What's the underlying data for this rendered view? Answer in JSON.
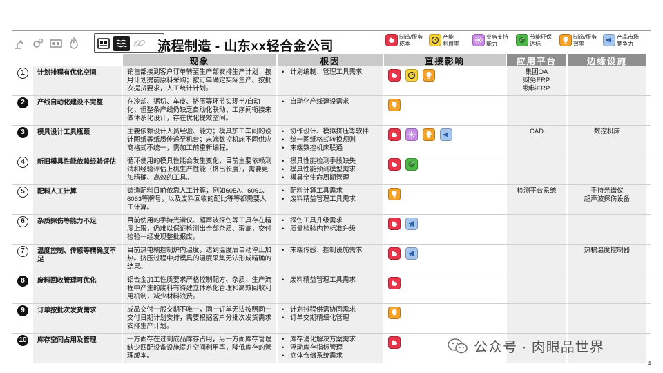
{
  "header": {
    "title": "流程制造 - 山东xx轻合金公司",
    "sector_icons": [
      "robot-arm-icon",
      "gears-icon",
      "machine-icon",
      "fire-flame-icon"
    ],
    "active_sector_icons": [
      "factory-panel-icon",
      "metal-rolls-icon",
      "chain-link-icon"
    ]
  },
  "legend": [
    {
      "key": "red",
      "label": "制造/服务\n成本",
      "color": "#e8354a",
      "icon": "piggy-bank-icon"
    },
    {
      "key": "yellow",
      "label": "产能\n利用率",
      "color": "#f6d23a",
      "icon": "gauge-icon"
    },
    {
      "key": "purple",
      "label": "业务支持\n能力",
      "color": "#c78be6",
      "icon": "star-burst-icon"
    },
    {
      "key": "green",
      "label": "节能环保\n达标",
      "color": "#4fb848",
      "icon": "leaf-globe-icon"
    },
    {
      "key": "orange",
      "label": "制造/服务\n效率",
      "color": "#f3a22a",
      "icon": "lightbulb-icon"
    },
    {
      "key": "blue",
      "label": "产品市场\n竞争力",
      "color": "#a7c6ee",
      "icon": "megaphone-icon"
    }
  ],
  "columns": {
    "phenomenon": "现象",
    "cause": "根因",
    "impact": "直接影响",
    "platform": "应用平台",
    "infrastructure": "边缘设施"
  },
  "rows": [
    {
      "num": "1",
      "style": "outline",
      "title": "计划排程有优化空间",
      "phenomenon": "销售部接到客户订单转至生产部安排生产计划；按月计划提前原料采购；按订单确定实际生产、按批次提货要求，人工统计计划。",
      "causes": [
        "计划编制、管理工具需求"
      ],
      "impacts": [
        "red",
        "yellow",
        "orange"
      ],
      "platform": "集团OA\n财务ERP\n物料ERP",
      "infra": ""
    },
    {
      "num": "2",
      "style": "filled",
      "title": "产线自动化建设不完整",
      "phenomenon": "在冷却、锯切、车皮、挤压等环节实现半/自动化，但整条产线仍缺乏自动化联动；工序间衔接未做体系化设计，存在优化提效空间。",
      "causes": [
        "自动化产线建设需求"
      ],
      "impacts": [
        "orange"
      ],
      "platform": "",
      "infra": ""
    },
    {
      "num": "3",
      "style": "filled",
      "title": "模具设计工具瓶颈",
      "phenomenon": "主要依赖设计人员经验、能力；模具加工车间的设计图纸等纸质传递至机台；末端数控机床不同供应商格式不统一，需加工前重新编程。",
      "causes": [
        "协作设计、模拟挤压等软件",
        "统一图纸格式转换规则",
        "末端数控机床联通"
      ],
      "impacts": [
        "red",
        "purple",
        "orange",
        "blue"
      ],
      "platform": "CAD",
      "infra": "数控机床"
    },
    {
      "num": "4",
      "style": "outline",
      "title": "新旧模具性能依赖经验评估",
      "phenomenon": "循环使用的模具性能会发生变化，目前主要依赖测试和经验评估上机生产性能（挤出长度），需要更加精确、高效的工具。",
      "causes": [
        "模具性能检测手段缺失",
        "模具性能预测模型需求",
        "模具全生命周期管理"
      ],
      "impacts": [
        "red",
        "green"
      ],
      "platform": "",
      "infra": ""
    },
    {
      "num": "5",
      "style": "outline",
      "title": "配料人工计算",
      "phenomenon": "铸造配料目前依靠人工计算；例如605A、6061、6063等牌号，以及废料回收的配比等等都需要人工计算。",
      "causes": [
        "配料计算工具需求",
        "废料精益管理工具需求"
      ],
      "impacts": [
        "orange"
      ],
      "platform": "检测平台系统",
      "infra": "手持光谱仪\n超声波探伤设备"
    },
    {
      "num": "6",
      "style": "outline",
      "title": "杂质探伤等能力不足",
      "phenomenon": "目前使用的手持光谱仪、超声波探伤等工具存在精度上限，仍难以保证检测出全部杂质、瑕疵，交付检验一经发现整批报废。",
      "causes": [
        "探伤工具升级需求",
        "质量检验内控标准升级"
      ],
      "impacts": [
        "red",
        "blue"
      ],
      "platform": "",
      "infra": ""
    },
    {
      "num": "7",
      "style": "outline",
      "title": "温度控制、传感等精确度不足",
      "phenomenon": "目前热电耦控制炉内温度，达到温度后自动停止加热。挤压过程中对模具的温度采集无法形成精确的结果。",
      "causes": [
        "末端传感、控制设施需求"
      ],
      "impacts": [
        "red",
        "blue"
      ],
      "platform": "",
      "infra": "热耦温度控制器"
    },
    {
      "num": "8",
      "style": "filled",
      "title": "废料回收管理可优化",
      "phenomenon": "铝合金加工性质要求严格控制配方、杂质；生产流程中产生的废料有待建立体系化管理和高效回收利用机制，减少材料浪费。",
      "causes": [
        "废料精益管理工具需求"
      ],
      "impacts": [
        "red"
      ],
      "platform": "",
      "infra": ""
    },
    {
      "num": "9",
      "style": "filled",
      "title": "订单按批次发货需求",
      "phenomenon": "成品交付一般交期不唯一，同一订单无法按照同一交付日期计划安排，需要根据客户分批次发货需求安排生产计划。",
      "causes": [
        "计划排程供需协同需求",
        "订单交期精细化管理"
      ],
      "impacts": [
        "orange"
      ],
      "platform": "",
      "infra": ""
    },
    {
      "num": "10",
      "style": "filled",
      "title": "库存空间占用及管理",
      "phenomenon": "一方面存在过剩成品库存占用，另一方面库存管理缺少匹配设备设施提升空间利用率，降低库存的管理成本。",
      "causes": [
        "库存消化解决方案需求",
        "浮动库存指标管理",
        "立体仓储系统需求"
      ],
      "impacts": [
        "red"
      ],
      "platform": "",
      "infra": ""
    }
  ],
  "watermark": "公众号 · 肉眼品世界",
  "page_number": "4"
}
